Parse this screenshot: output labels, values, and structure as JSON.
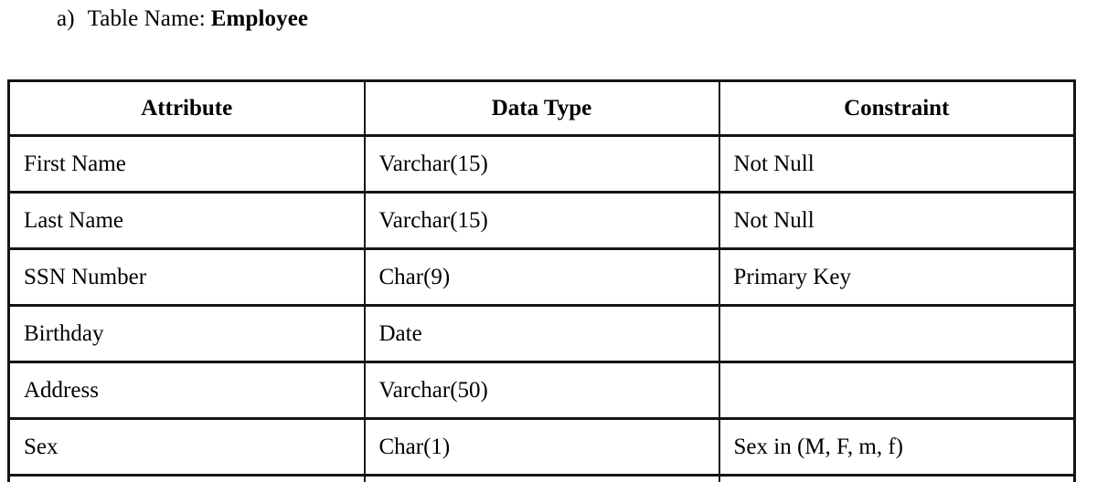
{
  "heading": {
    "marker": "a)",
    "label": "Table Name:",
    "value": "Employee"
  },
  "table": {
    "columns": [
      "Attribute",
      "Data Type",
      "Constraint"
    ],
    "rows": [
      {
        "attribute": "First Name",
        "data_type": "Varchar(15)",
        "constraint": "Not Null"
      },
      {
        "attribute": "Last Name",
        "data_type": "Varchar(15)",
        "constraint": "Not Null"
      },
      {
        "attribute": "SSN Number",
        "data_type": "Char(9)",
        "constraint": "Primary Key"
      },
      {
        "attribute": "Birthday",
        "data_type": "Date",
        "constraint": ""
      },
      {
        "attribute": "Address",
        "data_type": "Varchar(50)",
        "constraint": ""
      },
      {
        "attribute": "Sex",
        "data_type": "Char(1)",
        "constraint": "Sex in (M, F, m, f)"
      },
      {
        "attribute": "",
        "data_type": "",
        "constraint": ""
      }
    ]
  },
  "colors": {
    "text": "#000000",
    "border": "#141414",
    "background": "#ffffff"
  }
}
